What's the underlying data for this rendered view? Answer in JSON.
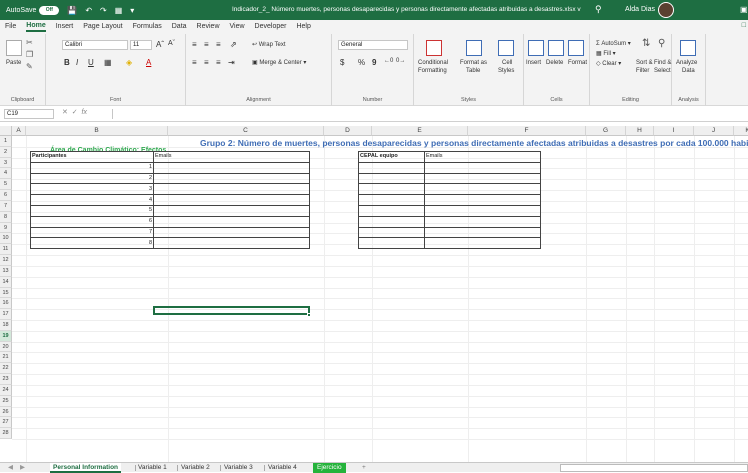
{
  "titlebar": {
    "autosave_label": "AutoSave",
    "autosave_state": "Off",
    "filename": "Indicador_2_ Número muertes, personas desaparecidas y personas directamente afectadas atribuidas a desastres.xlsx",
    "filename_suffix": "v",
    "user_name": "Alda Dias"
  },
  "menu": {
    "items": [
      "File",
      "Home",
      "Insert",
      "Page Layout",
      "Formulas",
      "Data",
      "Review",
      "View",
      "Developer",
      "Help"
    ],
    "active": "Home"
  },
  "ribbon": {
    "clipboard": {
      "label": "Clipboard",
      "paste": "Paste"
    },
    "font": {
      "label": "Font",
      "font_name": "Calibri",
      "font_size": "11",
      "bold": "B",
      "italic": "I",
      "underline": "U"
    },
    "alignment": {
      "label": "Alignment",
      "wrap_text": "Wrap Text",
      "merge_center": "Merge & Center"
    },
    "number": {
      "label": "Number",
      "format": "General",
      "currency": "$",
      "percent": "%",
      "comma": "9"
    },
    "styles": {
      "label": "Styles",
      "conditional": "Conditional",
      "conditional2": "Formatting",
      "format_as": "Format as",
      "format_as2": "Table",
      "cell": "Cell",
      "cell2": "Styles"
    },
    "cells": {
      "label": "Cells",
      "insert": "Insert",
      "delete": "Delete",
      "format": "Format"
    },
    "editing": {
      "label": "Editing",
      "autosum": "AutoSum",
      "fill": "Fill",
      "clear": "Clear",
      "sort": "Sort &",
      "sort2": "Filter",
      "find": "Find &",
      "find2": "Select"
    },
    "analysis": {
      "label": "Analysis",
      "analyze": "Analyze",
      "analyze2": "Data"
    }
  },
  "formula_bar": {
    "cell_ref": "C19",
    "fx": "fx",
    "value": ""
  },
  "columns": [
    "A",
    "B",
    "C",
    "D",
    "E",
    "F",
    "G",
    "H",
    "I",
    "J",
    "K"
  ],
  "rows": [
    "1",
    "2",
    "3",
    "4",
    "5",
    "6",
    "7",
    "8",
    "9",
    "10",
    "11",
    "12",
    "13",
    "14",
    "15",
    "16",
    "17",
    "18",
    "19",
    "20",
    "21",
    "22",
    "23",
    "24",
    "25",
    "26",
    "27",
    "28"
  ],
  "selected_row": "19",
  "sheet": {
    "title": "Grupo 2: Número de muertes, personas desaparecidas y personas directamente afectadas atribuidas a desastres por cada 100.000 habitantes (SDG 11.5.1)",
    "subtitle": "Área de Cambio Climático:  Efectos",
    "participants_table": {
      "headers": [
        "Participantes",
        "Emails"
      ],
      "row_numbers": [
        "1",
        "2",
        "3",
        "4",
        "5",
        "6",
        "7",
        "8"
      ]
    },
    "cepal_table": {
      "headers": [
        "CEPAL equipo",
        "Emails"
      ]
    }
  },
  "tabs": [
    "Personal Information",
    "Variable 1",
    "Variable 2",
    "Variable 3",
    "Variable 4",
    "Ejercicio"
  ],
  "active_tab": "Personal Information",
  "add_sheet": "+"
}
